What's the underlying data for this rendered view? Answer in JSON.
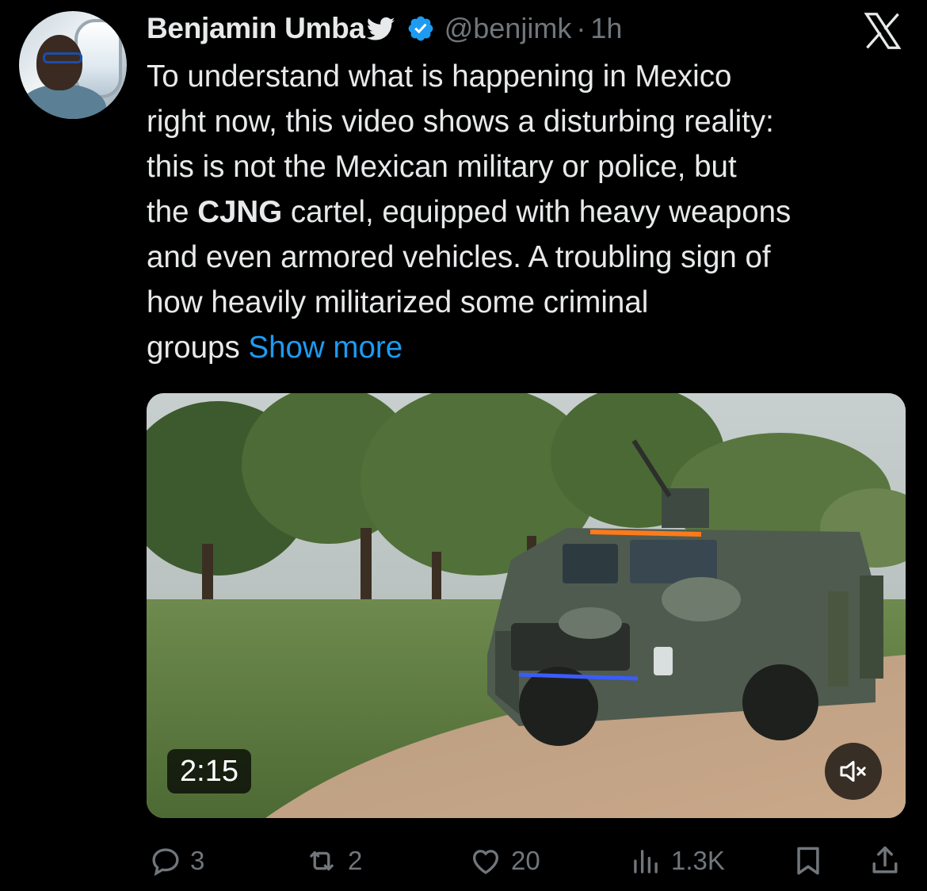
{
  "user": {
    "display_name": "Benjamin Umba",
    "handle": "@benjimk",
    "separator": "·",
    "time": "1h"
  },
  "icons": {
    "bird": "bird-icon",
    "verified": "verified-badge-icon",
    "platform_logo": "x-logo-icon",
    "mute": "speaker-muted-icon",
    "reply": "reply-icon",
    "repost": "repost-icon",
    "like": "heart-icon",
    "views": "views-bar-chart-icon",
    "bookmark": "bookmark-icon",
    "share": "share-icon"
  },
  "tweet": {
    "lines": [
      "To understand what is happening in Mexico",
      "right now, this video shows a disturbing reality:",
      "this is not the Mexican military or police, but"
    ],
    "line4_pre": "the ",
    "line4_bold": "CJNG",
    "line4_post": " cartel, equipped with heavy weapons",
    "line5": "and even armored vehicles. A troubling sign of",
    "line6": "how heavily militarized some criminal",
    "line7": "groups ",
    "show_more": "Show more"
  },
  "media": {
    "duration": "2:15"
  },
  "actions": {
    "replies": "3",
    "reposts": "2",
    "likes": "20",
    "views": "1.3K"
  },
  "colors": {
    "background": "#000000",
    "text": "#e7e9ea",
    "muted": "#71767b",
    "link": "#1d9bf0",
    "verified": "#1d9bf0"
  }
}
